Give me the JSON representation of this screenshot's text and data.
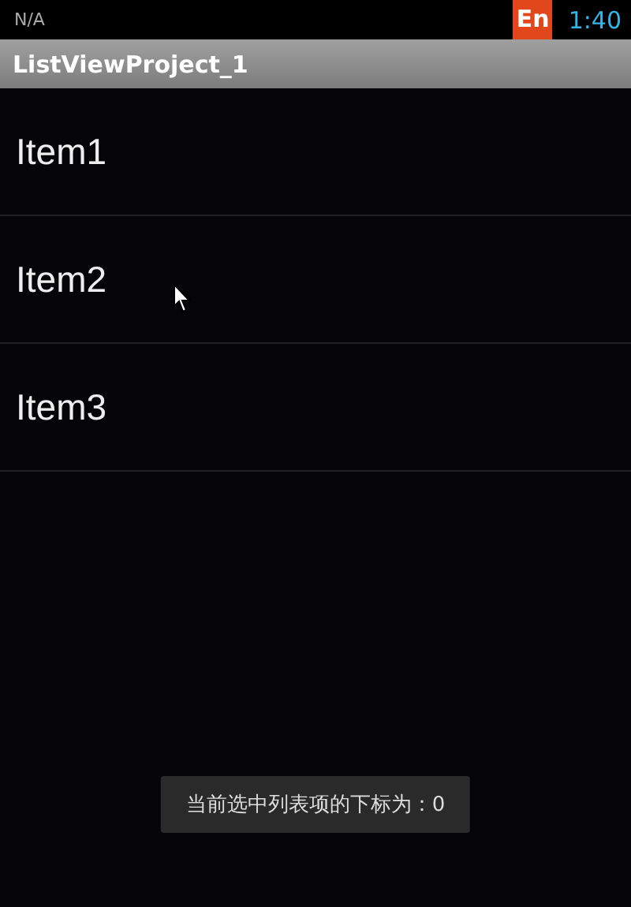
{
  "status_bar": {
    "carrier": "N/A",
    "input_method": "En",
    "time": "1:40"
  },
  "title_bar": {
    "title": "ListViewProject_1"
  },
  "list": {
    "items": [
      {
        "label": "Item1"
      },
      {
        "label": "Item2"
      },
      {
        "label": "Item3"
      }
    ]
  },
  "toast": {
    "message": "当前选中列表项的下标为：0"
  }
}
